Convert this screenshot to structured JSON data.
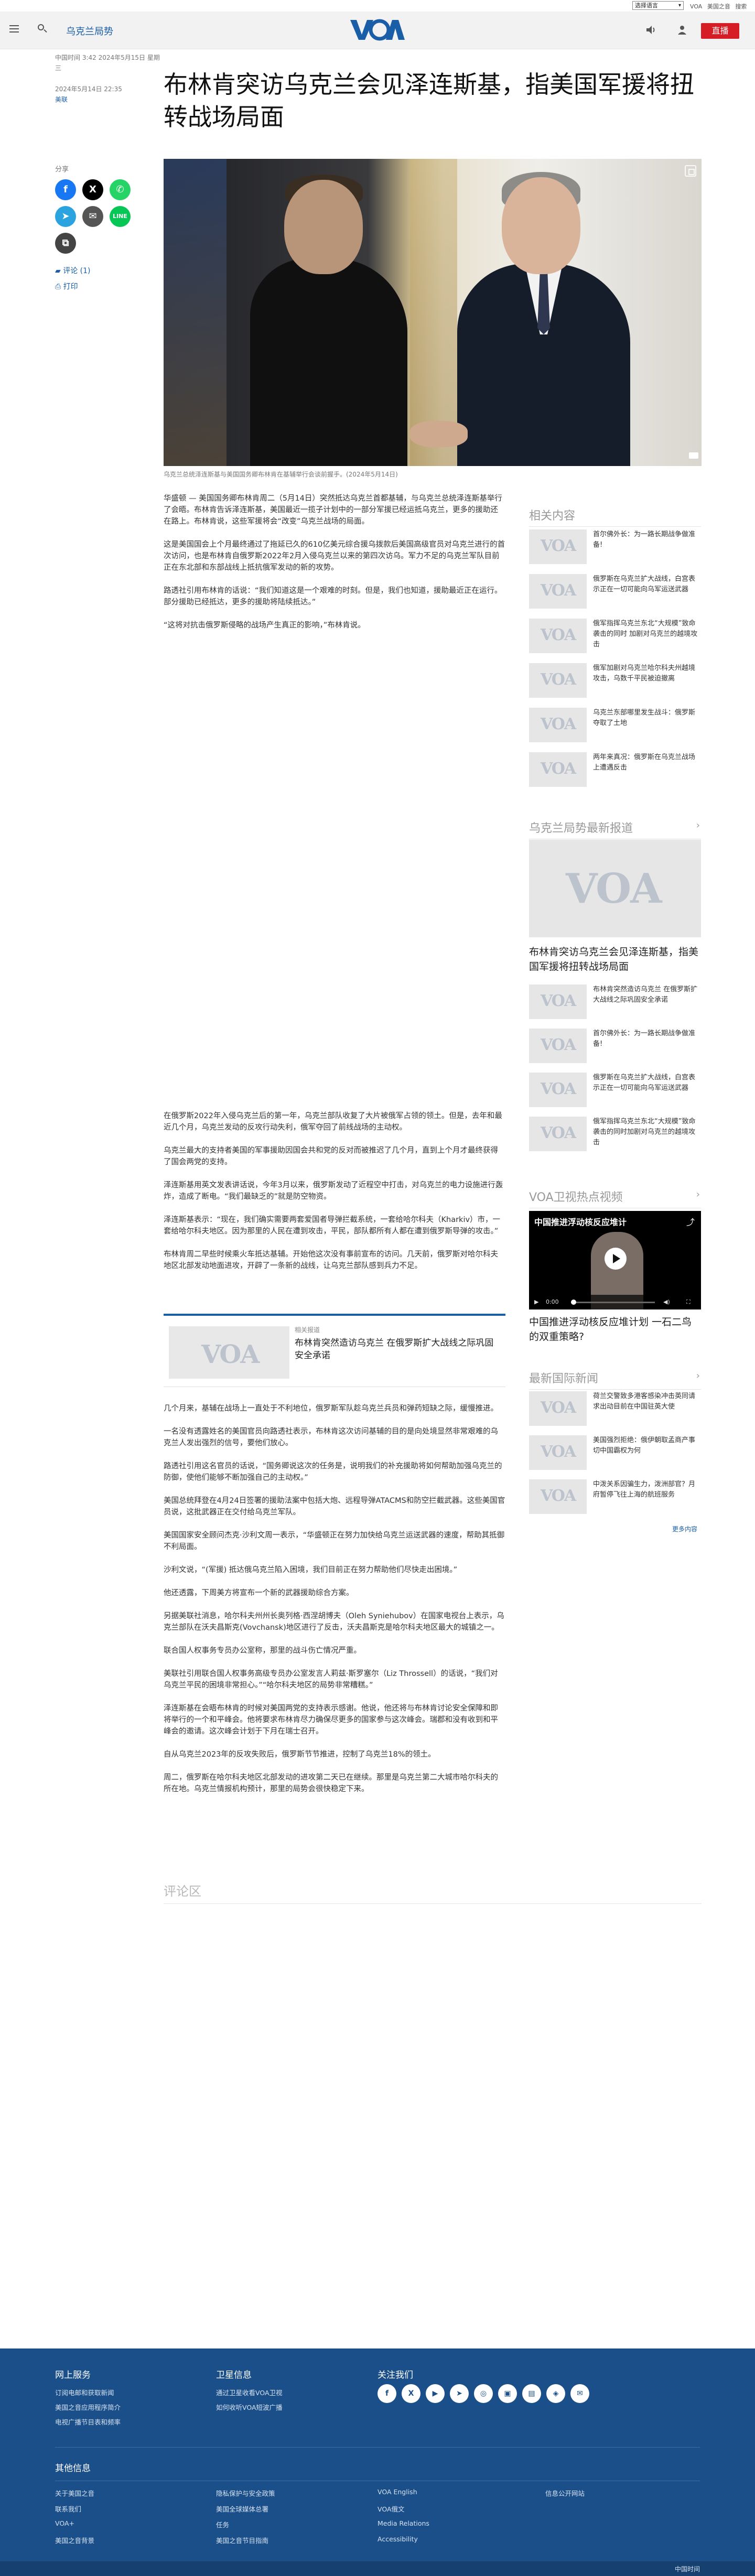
{
  "topbar": {
    "language": "选择语言",
    "links": [
      "VOA",
      "美国之音",
      "搜索"
    ]
  },
  "header": {
    "section": "乌克兰局势",
    "logo": "VOA",
    "live_label": "直播"
  },
  "article": {
    "meta_line": "中国时间 3:42 2024年5月15日 星期三",
    "date": "2024年5月14日 22:35",
    "author": "美联",
    "title": "布林肯突访乌克兰会见泽连斯基，指美国军援将扭转战场局面",
    "caption": "乌克兰总统泽连斯基与美国国务卿布林肯在基辅举行会谈前握手。(2024年5月14日)",
    "share_label": "分享",
    "comments_label": "评论 (1)",
    "print_label": "打印",
    "paragraphs_a": [
      "华盛顿 — 美国国务卿布林肯周二（5月14日）突然抵达乌克兰首都基辅，与乌克兰总统泽连斯基举行了会晤。布林肯告诉泽连斯基，美国最近一揽子计划中的一部分军援已经运抵乌克兰，更多的援助还在路上。布林肯说，这些军援将会“改变”乌克兰战场的局面。",
      "这是美国国会上个月最终通过了拖延已久的610亿美元综合援乌拨款后美国高级官员对乌克兰进行的首次访问，也是布林肯自俄罗斯2022年2月入侵乌克兰以来的第四次访乌。军力不足的乌克兰军队目前正在东北部和东部战线上抵抗俄军发动的新的攻势。",
      "路透社引用布林肯的话说：“我们知道这是一个艰难的时刻。但是，我们也知道，援助最近正在运行。部分援助已经抵达，更多的援助将陆续抵达。”",
      "“这将对抗击俄罗斯侵略的战场产生真正的影响，”布林肯说。"
    ],
    "paragraphs_b": [
      "在俄罗斯2022年入侵乌克兰后的第一年，乌克兰部队收复了大片被俄军占领的领土。但是，去年和最近几个月，乌克兰发动的反攻行动失利，俄军夺回了前线战场的主动权。",
      "乌克兰最大的支持者美国的军事援助因国会共和党的反对而被推迟了几个月，直到上个月才最终获得了国会两党的支持。",
      "泽连斯基用英文发表讲话说，今年3月以来，俄罗斯发动了近程空中打击，对乌克兰的电力设施进行轰炸，造成了断电。“我们最缺乏的”就是防空物资。",
      "泽连斯基表示：“现在，我们确实需要两套爱国者导弹拦截系统，一套给哈尔科夫（Kharkiv）市，一套给哈尔科夫地区。因为那里的人民在遭到攻击，平民，部队都所有人都在遭到俄罗斯导弹的攻击。”",
      "布林肯周二早些时候乘火车抵达基辅。开始他这次没有事前宣布的访问。几天前，俄罗斯对哈尔科夫地区北部发动地面进攻，开辟了一条新的战线，让乌克兰部队感到兵力不足。"
    ],
    "related_card": {
      "label": "相关报道",
      "title": "布林肯突然造访乌克兰 在俄罗斯扩大战线之际巩固安全承诺"
    },
    "paragraphs_c": [
      "几个月来，基辅在战场上一直处于不利地位，俄罗斯军队趁乌克兰兵员和弹药短缺之际，缓慢推进。",
      "一名没有透露姓名的美国官员向路透社表示，布林肯这次访问基辅的目的是向处境显然非常艰难的乌克兰人发出强烈的信号，要他们放心。",
      "路透社引用这名官员的话说，“国务卿说这次的任务是，说明我们的补充援助将如何帮助加强乌克兰的防御，使他们能够不断加强自己的主动权。”",
      "美国总统拜登在4月24日签署的援助法案中包括大炮、远程导弹ATACMS和防空拦截武器。这些美国官员说，这批武器正在交付给乌克兰军队。",
      "美国国家安全顾问杰克·沙利文周一表示，“华盛顿正在努力加快给乌克兰运送武器的速度，帮助其抵御不利局面。",
      "沙利文说，“(军援) 抵达俄乌克兰陷入困境，我们目前正在努力帮助他们尽快走出困境。”",
      "他还透露，下周美方将宣布一个新的武器援助综合方案。",
      "另据美联社消息，哈尔科夫州州长奥列格·西涅胡博夫（Oleh Syniehubov）在国家电视台上表示，乌克兰部队在沃夫昌斯克(Vovchansk)地区进行了反击，沃夫昌斯克是哈尔科夫地区最大的城镇之一。",
      "联合国人权事务专员办公室称，那里的战斗伤亡情况严重。",
      "美联社引用联合国人权事务高级专员办公室发言人莉兹·斯罗塞尔（Liz Throssell）的话说，“我们对乌克兰平民的困境非常担心。”“哈尔科夫地区的局势非常糟糕。”",
      "泽连斯基在会晤布林肯的时候对美国两党的支持表示感谢。他说，他还将与布林肯讨论安全保障和即将举行的一个和平峰会。他将要求布林肯尽力确保尽更多的国家参与这次峰会。瑞郡和没有收到和平峰会的邀请。这次峰会计划于下月在瑞士召开。",
      "自从乌克兰2023年的反攻失败后，俄罗斯节节推进，控制了乌克兰18%的领土。",
      "周二，俄罗斯在哈尔科夫地区北部发动的进攻第二天已在继续。那里是乌克兰第二大城市哈尔科夫的所在地。乌克兰情报机构预计，那里的局势会很快稳定下来。"
    ],
    "comments_heading": "评论区"
  },
  "sidebar": {
    "related_heading": "相关内容",
    "related": [
      "首尔佛外长：为一路长期战争做准备!",
      "俄罗斯在乌克兰扩大战线，白宫表示正在一切可能向乌军运送武器",
      "俄军指挥乌克兰东北“大规模”致命袭击的同时 加剧对乌克兰的越境攻击",
      "俄军加剧对乌克兰哈尔科夫州越境攻击，乌数千平民被迫撤离",
      "乌克兰东部哪里发生战斗：俄罗斯夺取了土地",
      "两年来真况：俄罗斯在乌克兰战场上遭遇反击"
    ],
    "latest_heading": "乌克兰局势最新报道",
    "latest_big_title": "布林肯突访乌克兰会见泽连斯基，指美国军援将扭转战场局面",
    "latest": [
      "布林肯突然造访乌克兰 在俄罗斯扩大战线之际巩固安全承诺",
      "首尔佛外长：为一路长期战争做准备!",
      "俄罗斯在乌克兰扩大战线，白宫表示正在一切可能向乌军运送武器",
      "俄军指挥乌克兰东北“大规模”致命袭击的同时加剧对乌克兰的越境攻击"
    ],
    "video_heading": "VOA卫视热点视频",
    "video_overlay": "中国推进浮动核反应堆计",
    "video_time": "0:00",
    "video_title": "中国推进浮动核反应堆计划 一石二鸟的双重策略?",
    "world_heading": "最新国际新闻",
    "world": [
      "荷兰交警致多港客感染冲击英同请求出动目前在中国驻英大使",
      "美国强烈拒绝：俄伊朝取孟商产事 切中国霸权为何",
      "中泼关系因骗生力，泼洲部官？月府暂停飞往上海的航班服务"
    ],
    "more_link": "更多内容"
  },
  "footer": {
    "col1_head": "网上服务",
    "col1": [
      "订阅电邮和获取新闻",
      "美国之音应用程序简介",
      "电视广播节目表和频率"
    ],
    "col2_head": "卫星信息",
    "col2": [
      "通过卫星收看VOA卫视",
      "如何收听VOA短波广播"
    ],
    "col3_head": "关注我们",
    "socials": [
      "f",
      "X",
      "▶",
      "➤",
      "◎",
      "▣",
      "▤",
      "◈",
      "✉"
    ],
    "other_head": "其他信息",
    "other": [
      [
        "关于美国之音",
        "联系我们",
        "VOA+",
        "美国之音背景"
      ],
      [
        "隐私保护与安全政策",
        "美国全球媒体总署",
        "任务",
        "美国之音节目指南"
      ],
      [
        "VOA English",
        "VOA俄文",
        "Media Relations",
        "Accessibility"
      ],
      [
        "信息公开网站"
      ]
    ],
    "bottom": "中国时间"
  }
}
